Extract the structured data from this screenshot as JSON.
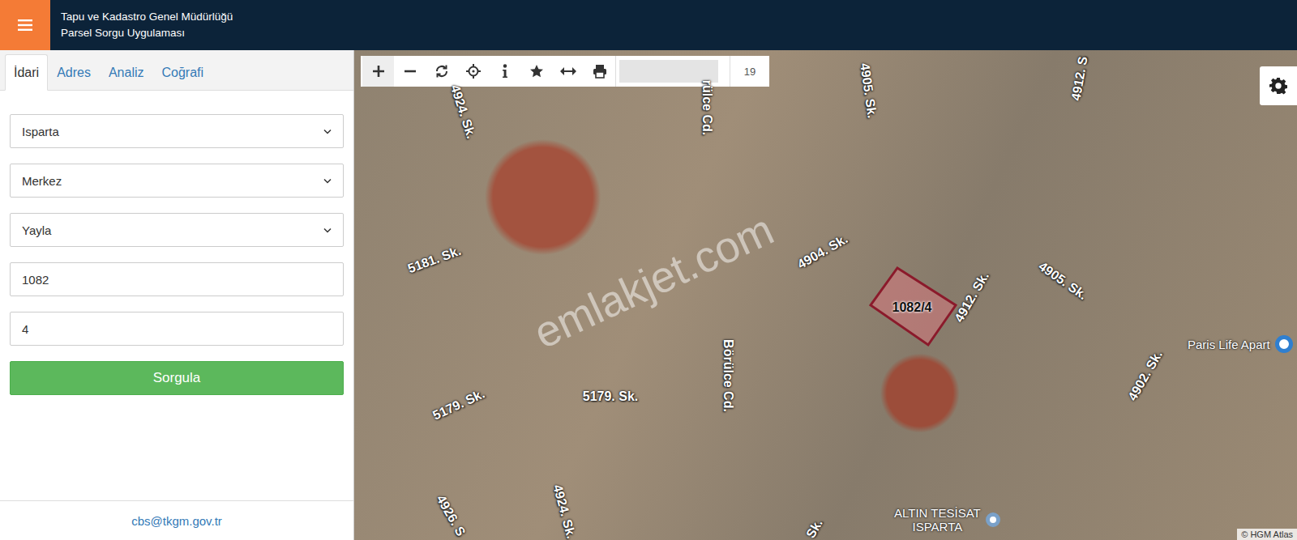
{
  "header": {
    "title_lines": [
      "Tapu ve Kadastro Genel Müdürlüğü",
      "Parsel Sorgu Uygulaması"
    ]
  },
  "tabs": [
    {
      "label": "İdari",
      "selected": true
    },
    {
      "label": "Adres",
      "selected": false
    },
    {
      "label": "Analiz",
      "selected": false
    },
    {
      "label": "Coğrafi",
      "selected": false
    }
  ],
  "fields": [
    {
      "kind": "select",
      "value": "Isparta"
    },
    {
      "kind": "select",
      "value": "Merkez"
    },
    {
      "kind": "select",
      "value": "Yayla"
    },
    {
      "kind": "input",
      "value": "1082"
    },
    {
      "kind": "input",
      "value": "4"
    }
  ],
  "query_button": "Sorgula",
  "footer": "cbs@tkgm.gov.tr",
  "map": {
    "toolbar": {
      "zoom": "19"
    },
    "street_labels": [
      "5181. Sk.",
      "4924. Sk.",
      "rülce Cd.",
      "4905. Sk.",
      "4912. S",
      "4904. Sk.",
      "4912. Sk.",
      "4905. Sk.",
      "4902. Sk.",
      "5179. Sk.",
      "5179. Sk.",
      "Börülce Cd.",
      "4926. S",
      "4924. Sk.",
      "Sk."
    ],
    "parcel": {
      "label": "1082/4"
    },
    "pois": [
      {
        "lines": [
          "Paris Life Apart"
        ]
      },
      {
        "lines": [
          "ALTIN TESİSAT",
          "ISPARTA"
        ]
      }
    ],
    "watermark": "emlakjet.com",
    "attribution": "© HGM Atlas"
  }
}
